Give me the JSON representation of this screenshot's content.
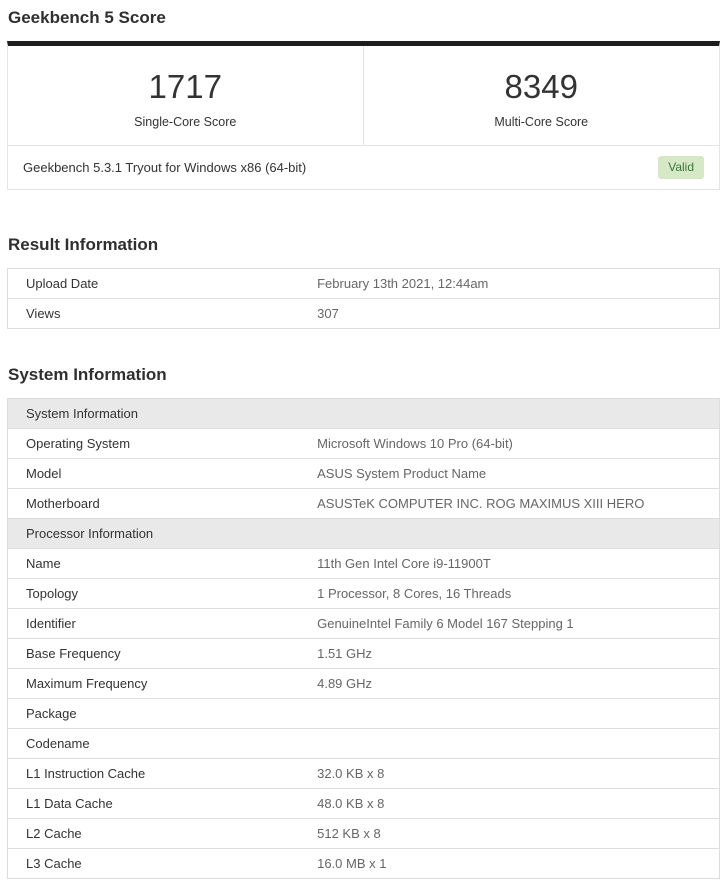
{
  "page": {
    "title": "Geekbench 5 Score"
  },
  "score_card": {
    "scores": [
      {
        "value": "1717",
        "label": "Single-Core Score"
      },
      {
        "value": "8349",
        "label": "Multi-Core Score"
      }
    ],
    "footer": {
      "text": "Geekbench 5.3.1 Tryout for Windows x86 (64-bit)",
      "badge": "Valid"
    }
  },
  "result_information": {
    "heading": "Result Information",
    "rows": [
      {
        "label": "Upload Date",
        "value": "February 13th 2021, 12:44am"
      },
      {
        "label": "Views",
        "value": "307"
      }
    ]
  },
  "system_information": {
    "heading": "System Information",
    "sections": [
      {
        "header": "System Information",
        "rows": [
          {
            "label": "Operating System",
            "value": "Microsoft Windows 10 Pro (64-bit)"
          },
          {
            "label": "Model",
            "value": "ASUS System Product Name"
          },
          {
            "label": "Motherboard",
            "value": "ASUSTeK COMPUTER INC. ROG MAXIMUS XIII HERO"
          }
        ]
      },
      {
        "header": "Processor Information",
        "rows": [
          {
            "label": "Name",
            "value": "11th Gen Intel Core i9-11900T"
          },
          {
            "label": "Topology",
            "value": "1 Processor, 8 Cores, 16 Threads"
          },
          {
            "label": "Identifier",
            "value": "GenuineIntel Family 6 Model 167 Stepping 1"
          },
          {
            "label": "Base Frequency",
            "value": "1.51 GHz"
          },
          {
            "label": "Maximum Frequency",
            "value": "4.89 GHz"
          },
          {
            "label": "Package",
            "value": ""
          },
          {
            "label": "Codename",
            "value": ""
          },
          {
            "label": "L1 Instruction Cache",
            "value": "32.0 KB x 8"
          },
          {
            "label": "L1 Data Cache",
            "value": "48.0 KB x 8"
          },
          {
            "label": "L2 Cache",
            "value": "512 KB x 8"
          },
          {
            "label": "L3 Cache",
            "value": "16.0 MB x 1"
          }
        ]
      }
    ]
  },
  "colors": {
    "card-top-bar": "#1d1d1d",
    "border": "#dddddd",
    "section-header-bg": "#e9e9e9",
    "badge-bg": "#d6e9c6",
    "badge-text": "#3c763d",
    "heading-text": "#2f2f2f",
    "value-text": "#666666"
  }
}
